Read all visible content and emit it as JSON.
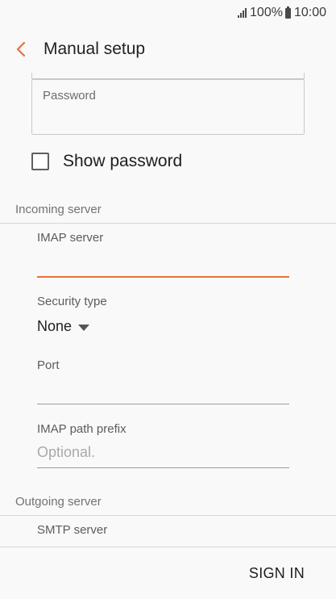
{
  "status_bar": {
    "signal_icon": "signal-icon",
    "battery_level": "100%",
    "battery_icon": "battery-icon",
    "time": "10:00"
  },
  "app_bar": {
    "back_icon": "chevron-left-icon",
    "title": "Manual setup"
  },
  "account": {
    "password_label": "Password",
    "password_value": "",
    "show_password_label": "Show password",
    "show_password_checked": false
  },
  "incoming": {
    "header": "Incoming server",
    "imap_server_label": "IMAP server",
    "imap_server_value": "",
    "security_type_label": "Security type",
    "security_type_value": "None",
    "port_label": "Port",
    "port_value": "",
    "imap_path_prefix_label": "IMAP path prefix",
    "imap_path_prefix_placeholder": "Optional."
  },
  "outgoing": {
    "header": "Outgoing server",
    "smtp_server_label": "SMTP server"
  },
  "actions": {
    "sign_in_label": "SIGN IN"
  },
  "colors": {
    "accent": "#e8703d",
    "background": "#f9f9f9"
  }
}
